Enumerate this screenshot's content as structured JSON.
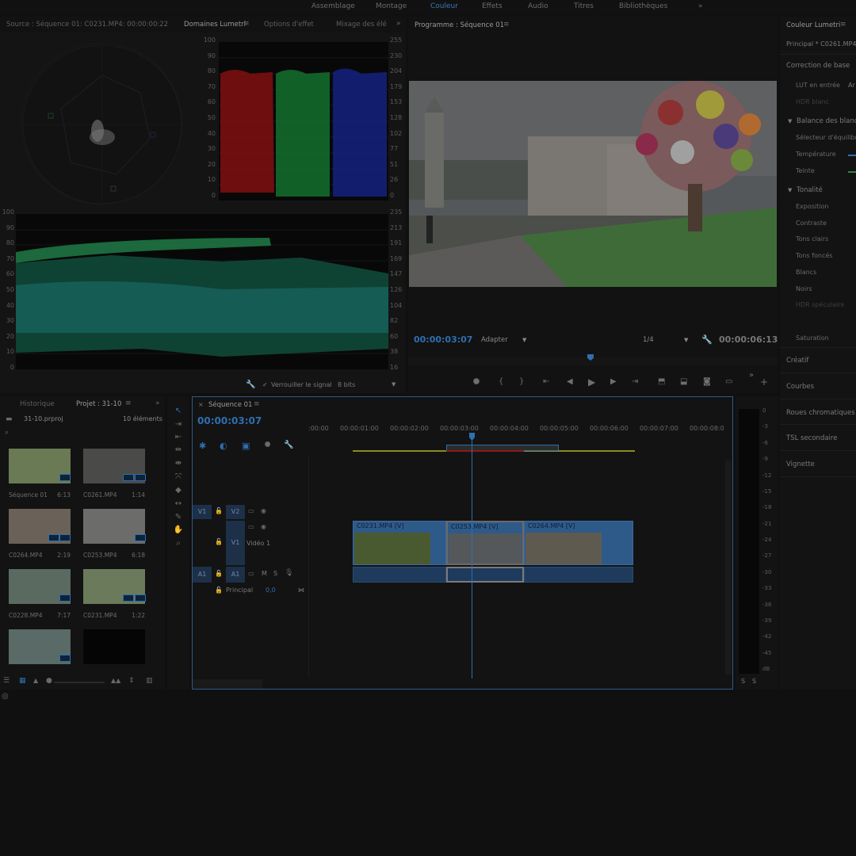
{
  "workspaces": [
    "Assemblage",
    "Montage",
    "Couleur",
    "Effets",
    "Audio",
    "Titres",
    "Bibliothèques"
  ],
  "workspace_active": "Couleur",
  "workspace_more": "»",
  "source_panel": {
    "tabs": [
      "Source : Séquence 01: C0231.MP4: 00:00:00:22",
      "Domaines Lumetri",
      "Options d'effet",
      "Mixage des élé"
    ],
    "active_tab": "Domaines Lumetri",
    "more": "»",
    "parade_left_scale": [
      "100",
      "90",
      "80",
      "70",
      "60",
      "50",
      "40",
      "30",
      "20",
      "10",
      "0"
    ],
    "parade_right_scale": [
      "255",
      "230",
      "204",
      "179",
      "153",
      "128",
      "102",
      "77",
      "51",
      "26",
      "0"
    ],
    "wave_left_scale": [
      "100",
      "90",
      "80",
      "70",
      "60",
      "50",
      "40",
      "30",
      "20",
      "10",
      "0"
    ],
    "wave_right_scale": [
      "235",
      "213",
      "191",
      "169",
      "147",
      "126",
      "104",
      "82",
      "60",
      "38",
      "16"
    ],
    "lock_signal": "Verrouiller le signal",
    "bits": "8 bits"
  },
  "program_panel": {
    "title": "Programme : Séquence 01",
    "timecode": "00:00:03:07",
    "fit": "Adapter",
    "resolution": "1/4",
    "duration": "00:00:06:13"
  },
  "lumetri": {
    "title": "Couleur Lumetri",
    "clip": "Principal * C0261.MP4",
    "section_basic": "Correction de base",
    "lut_label": "LUT en entrée",
    "lut_value": "Ar",
    "hdr_white": "HDR blanc",
    "white_balance": "Balance des blancs",
    "wb_selector": "Sélecteur d'équilibre",
    "temperature": "Température",
    "tint": "Teinte",
    "tone": "Tonalité",
    "exposure": "Exposition",
    "contrast": "Contraste",
    "highlights": "Tons clairs",
    "shadows": "Tons foncés",
    "whites": "Blancs",
    "blacks": "Noirs",
    "hdr_specular": "HDR spéculaire",
    "saturation": "Saturation",
    "creative": "Créatif",
    "curves": "Courbes",
    "color_wheels": "Roues chromatiques",
    "hsl": "TSL secondaire",
    "vignette": "Vignette"
  },
  "project_panel": {
    "tabs": [
      "Historique",
      "Projet : 31-10"
    ],
    "active_tab": "Projet : 31-10",
    "more": "»",
    "project_file": "31-10.prproj",
    "count": "10 éléments",
    "items": [
      {
        "name": "Séquence 01",
        "duration": "6:13"
      },
      {
        "name": "C0261.MP4",
        "duration": "1:14"
      },
      {
        "name": "C0264.MP4",
        "duration": "2:19"
      },
      {
        "name": "C0253.MP4",
        "duration": "6:18"
      },
      {
        "name": "C0228.MP4",
        "duration": "7:17"
      },
      {
        "name": "C0231.MP4",
        "duration": "1:22"
      },
      {
        "name": "",
        "duration": ""
      },
      {
        "name": "",
        "duration": ""
      }
    ]
  },
  "timeline": {
    "tab": "Séquence 01",
    "timecode": "00:00:03:07",
    "ruler": [
      ":00:00",
      "00:00:01:00",
      "00:00:02:00",
      "00:00:03:00",
      "00:00:04:00",
      "00:00:05:00",
      "00:00:06:00",
      "00:00:07:00",
      "00:00:08:0"
    ],
    "tracks": {
      "v2": "V2",
      "v1": "V1",
      "v1_target": "V1",
      "v1_name": "Vidéo 1",
      "a1": "A1",
      "a1_target": "A1",
      "mute": "M",
      "solo": "S",
      "master": "Principal",
      "master_value": "0,0"
    },
    "clips": [
      {
        "name": "C0231.MP4 [V]"
      },
      {
        "name": "C0253.MP4 [V]"
      },
      {
        "name": "C0264.MP4 [V]"
      }
    ]
  },
  "audio_meter": {
    "scale": [
      "0",
      "-3",
      "-6",
      "-9",
      "-12",
      "-15",
      "-18",
      "-21",
      "-24",
      "-27",
      "-30",
      "-33",
      "-36",
      "-39",
      "-42",
      "-45",
      "dB"
    ],
    "solo_left": "S",
    "solo_right": "S"
  },
  "colors": {
    "accent": "#2e6fb0",
    "clip_video": "#2e5a8a",
    "parade_red": "#b01515",
    "parade_green": "#14a03a",
    "parade_blue": "#1c2fb0"
  }
}
